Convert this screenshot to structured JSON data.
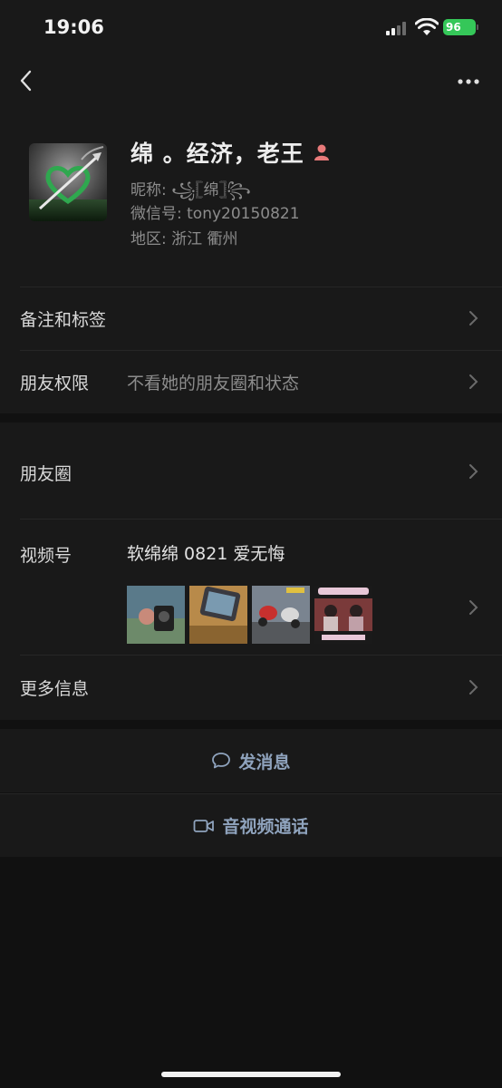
{
  "status_bar": {
    "time": "19:06",
    "battery": "96"
  },
  "profile": {
    "name": "绵 。经济，老王",
    "nickname": "昵称: ꧁𓊈绵𓊉꧂",
    "wechat_id": "微信号: tony20150821",
    "region": "地区: 浙江 衢州"
  },
  "rows": {
    "remarks_label": "备注和标签",
    "permissions_label": "朋友权限",
    "permissions_value": "不看她的朋友圈和状态",
    "moments_label": "朋友圈",
    "channels_label": "视频号",
    "channels_value": "软绵绵 0821 爱无悔",
    "more_info_label": "更多信息"
  },
  "actions": {
    "message_label": "发消息",
    "call_label": "音视频通话"
  },
  "colors": {
    "background": "#111111",
    "surface": "#191919",
    "action_text": "#8fa3bd",
    "battery": "#35c759"
  }
}
